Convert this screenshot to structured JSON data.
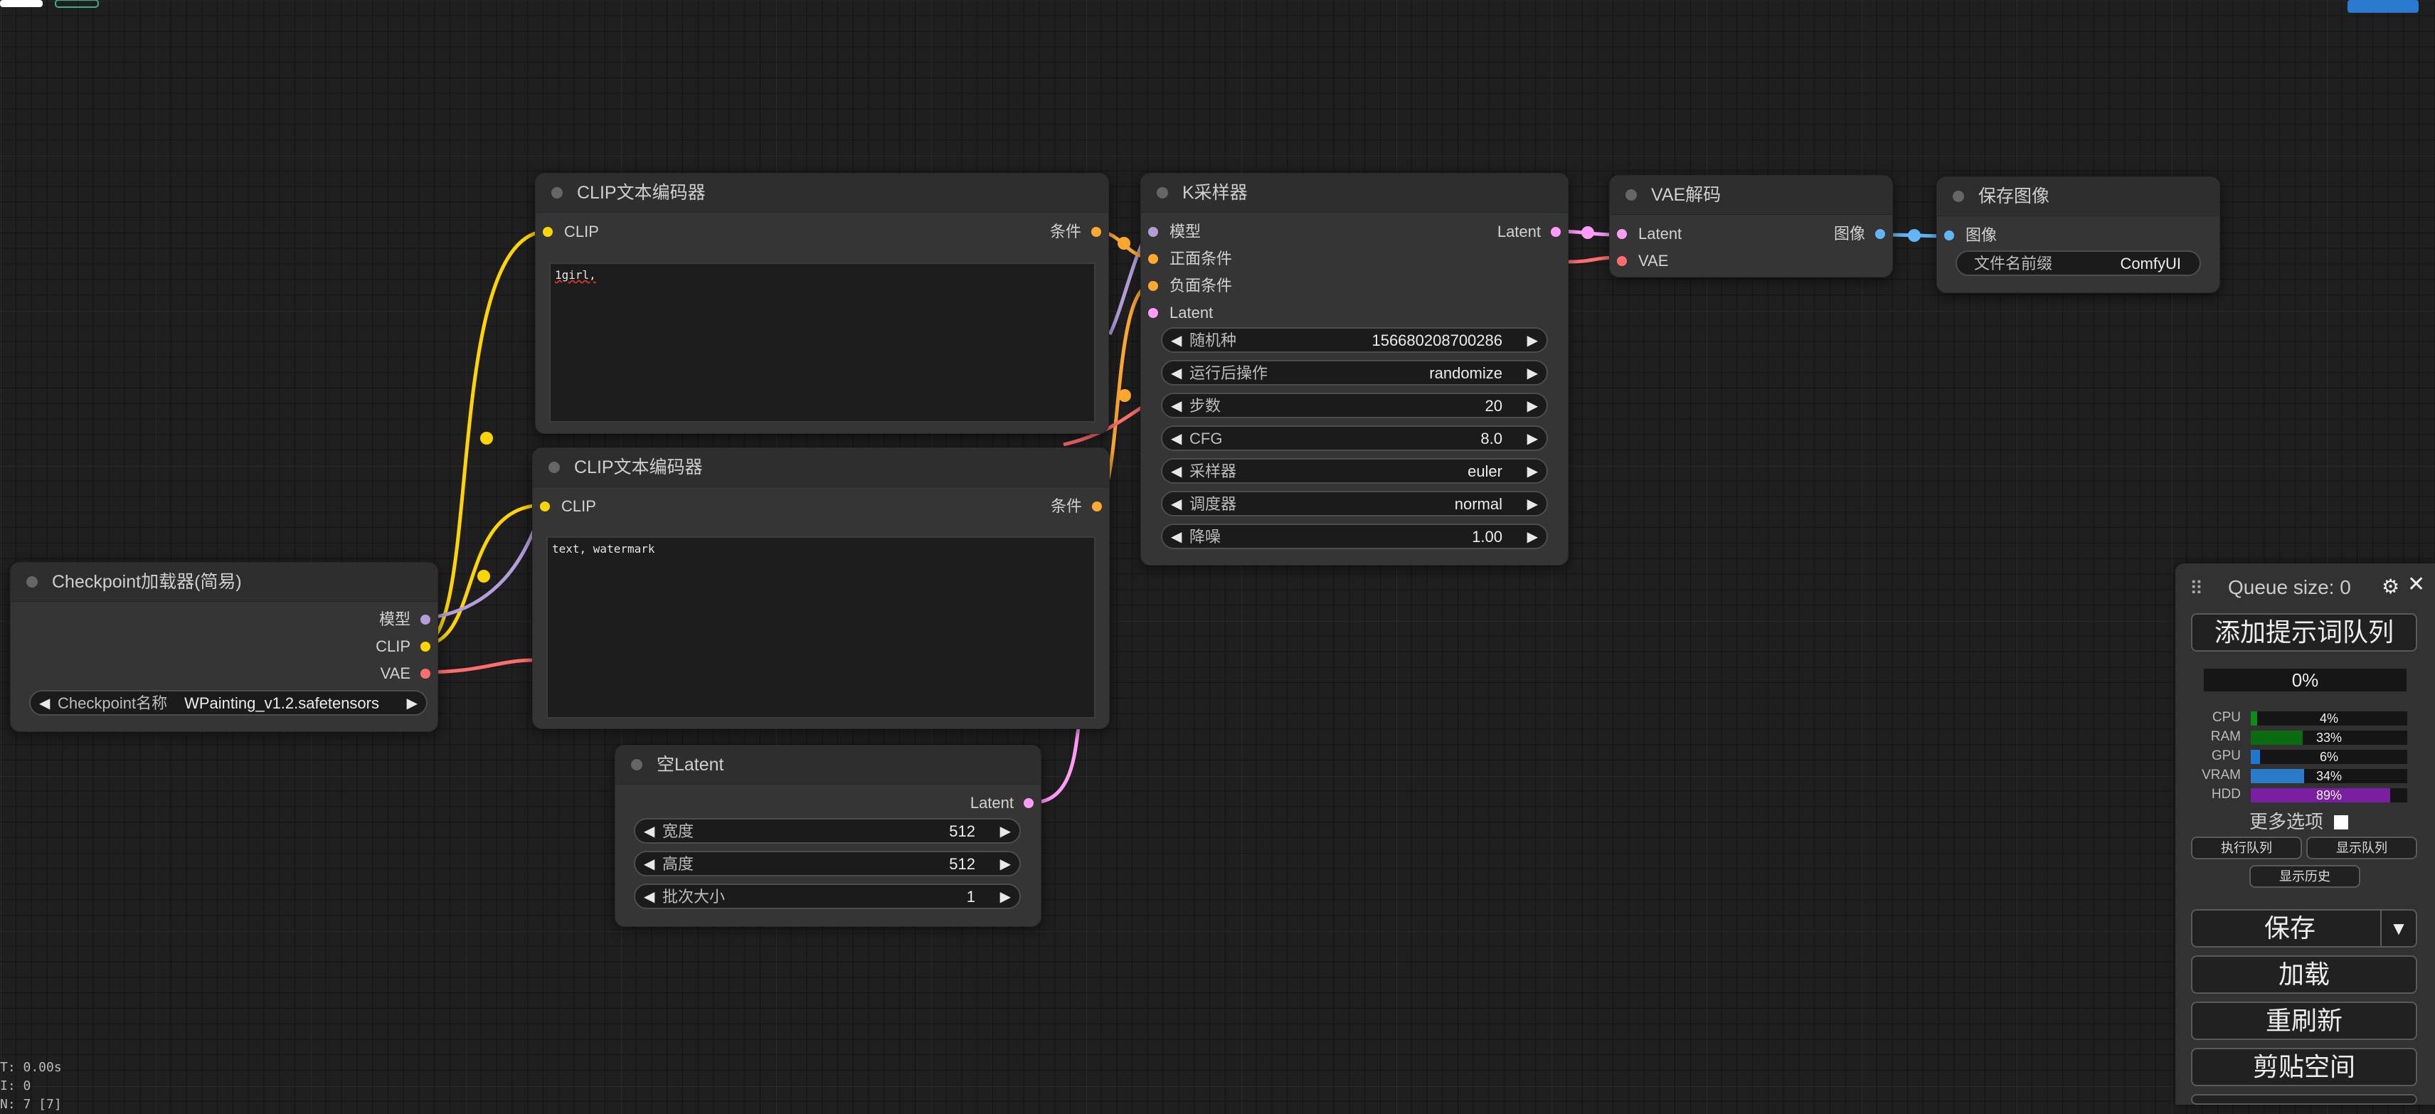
{
  "colors": {
    "model": "#b39ddb",
    "clip": "#ffd500",
    "vae": "#ff6e6e",
    "conditioning": "#ffa931",
    "latent": "#ff9cf9",
    "image": "#64b5f6"
  },
  "nodes": {
    "clip_pos": {
      "title": "CLIP文本编码器",
      "input_clip": "CLIP",
      "output": "条件",
      "text": "1girl,"
    },
    "clip_neg": {
      "title": "CLIP文本编码器",
      "input_clip": "CLIP",
      "output": "条件",
      "text": "text, watermark"
    },
    "ksampler": {
      "title": "K采样器",
      "inputs": [
        "模型",
        "正面条件",
        "负面条件",
        "Latent"
      ],
      "output": "Latent",
      "widgets": [
        {
          "label": "随机种",
          "value": "156680208700286"
        },
        {
          "label": "运行后操作",
          "value": "randomize"
        },
        {
          "label": "步数",
          "value": "20"
        },
        {
          "label": "CFG",
          "value": "8.0"
        },
        {
          "label": "采样器",
          "value": "euler"
        },
        {
          "label": "调度器",
          "value": "normal"
        },
        {
          "label": "降噪",
          "value": "1.00"
        }
      ]
    },
    "vae_decode": {
      "title": "VAE解码",
      "inputs": [
        "Latent",
        "VAE"
      ],
      "output": "图像"
    },
    "save_image": {
      "title": "保存图像",
      "input": "图像",
      "widget_label": "文件名前缀",
      "widget_value": "ComfyUI"
    },
    "checkpoint": {
      "title": "Checkpoint加载器(简易)",
      "outputs": [
        "模型",
        "CLIP",
        "VAE"
      ],
      "widget_label": "Checkpoint名称",
      "widget_value": "WPainting_v1.2.safetensors"
    },
    "empty_latent": {
      "title": "空Latent",
      "output": "Latent",
      "widgets": [
        {
          "label": "宽度",
          "value": "512"
        },
        {
          "label": "高度",
          "value": "512"
        },
        {
          "label": "批次大小",
          "value": "1"
        }
      ]
    }
  },
  "queue": {
    "title": "Queue size: 0",
    "add_prompt": "添加提示词队列",
    "progress": "0%",
    "monitors": [
      {
        "label": "CPU",
        "percent": 4,
        "text": "4%",
        "color": "#0f8a1a"
      },
      {
        "label": "RAM",
        "percent": 33,
        "text": "33%",
        "color": "#0a6b12"
      },
      {
        "label": "GPU",
        "percent": 6,
        "text": "6%",
        "color": "#1e78d2"
      },
      {
        "label": "VRAM",
        "percent": 34,
        "text": "34%",
        "color": "#2a7bc9"
      },
      {
        "label": "HDD",
        "percent": 89,
        "text": "89%",
        "color": "#7b1fa2"
      }
    ],
    "more_options": "更多选项",
    "exec_queue": "执行队列",
    "show_queue": "显示队列",
    "show_history": "显示历史",
    "save": "保存",
    "load": "加载",
    "refresh": "重刷新",
    "clipspace": "剪贴空间"
  },
  "stats": {
    "line1": "T: 0.00s",
    "line2": "I: 0",
    "line3": "N: 7 [7]"
  }
}
